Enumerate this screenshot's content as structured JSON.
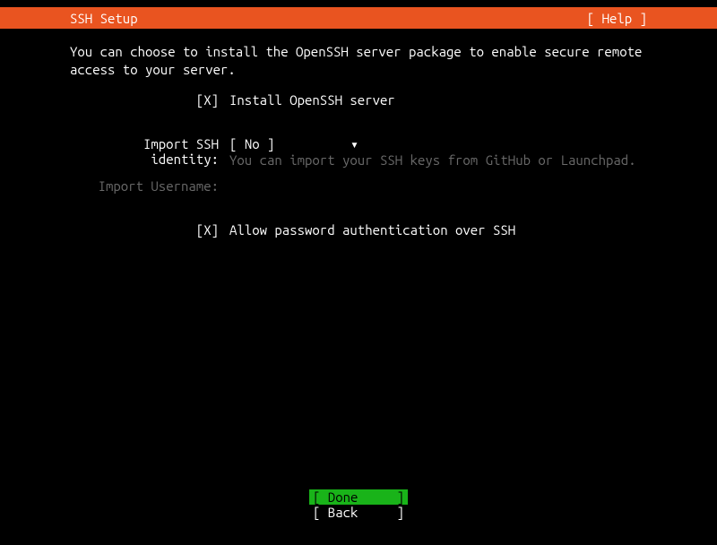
{
  "header": {
    "title": "SSH Setup",
    "help": "[ Help ]"
  },
  "intro": "You can choose to install the OpenSSH server package to enable secure remote access to your server.",
  "install_openssh": {
    "checkbox": "[X]",
    "label": "Install OpenSSH server"
  },
  "import_identity": {
    "label": "Import SSH identity:",
    "dropdown_open": "[ ",
    "dropdown_value": "No",
    "dropdown_arrow": "▾",
    "dropdown_close": " ]",
    "hint": "You can import your SSH keys from GitHub or Launchpad."
  },
  "import_username": {
    "label": "Import Username:"
  },
  "allow_password": {
    "checkbox": "[X]",
    "label": "Allow password authentication over SSH"
  },
  "footer": {
    "done_open": "[ ",
    "done_label": "Done",
    "done_close": "]",
    "back_open": "[ ",
    "back_label": "Back",
    "back_close": "]"
  }
}
